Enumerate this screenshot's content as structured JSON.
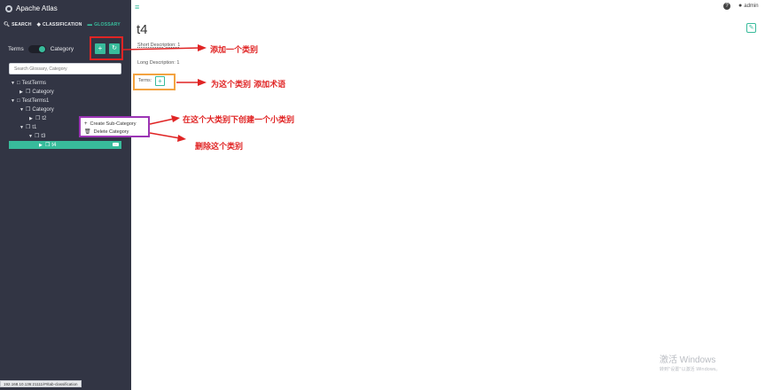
{
  "app": {
    "title": "Apache Atlas"
  },
  "tabs": [
    {
      "label": "SEARCH",
      "icon": "search-icon",
      "active": false
    },
    {
      "label": "CLASSIFICATION",
      "icon": "tag-icon",
      "active": false
    },
    {
      "label": "GLOSSARY",
      "icon": "folder-icon",
      "active": true
    }
  ],
  "toggle": {
    "left_label": "Terms",
    "right_label": "Category"
  },
  "search": {
    "placeholder": "Search Glossary, Category"
  },
  "tree": [
    {
      "label": "TestTerms",
      "icon": "folder-icon",
      "caret": "down"
    },
    {
      "label": "Category",
      "icon": "category-icon",
      "caret": "right"
    },
    {
      "label": "TestTerms1",
      "icon": "folder-icon",
      "caret": "down"
    },
    {
      "label": "Category",
      "icon": "category-icon",
      "caret": "down"
    },
    {
      "label": "t2",
      "icon": "category-icon",
      "caret": "right"
    },
    {
      "label": "t1",
      "icon": "category-icon",
      "caret": "down"
    },
    {
      "label": "t3",
      "icon": "category-icon",
      "caret": "down"
    },
    {
      "label": "t4",
      "icon": "category-icon",
      "caret": "right",
      "selected": true
    }
  ],
  "context_menu": {
    "create": "Create Sub-Category",
    "delete": "Delete Category"
  },
  "status_url": "192.168.10.136:21111/#!/tab-classification",
  "topbar": {
    "user": "admin"
  },
  "detail": {
    "title": "t4",
    "short_description": "Short Description: 1",
    "long_description": "Long Description: 1",
    "terms_label": "Terms:"
  },
  "annotations": {
    "add_category": "添加一个类别",
    "add_term": "为这个类别 添加术语",
    "create_sub": "在这个大类别下创建一个小类别",
    "delete": "删除这个类别"
  },
  "watermark": {
    "title": "激活 Windows",
    "subtitle": "转到\"设置\"以激活 Windows。"
  },
  "colors": {
    "sidebar": "#323544",
    "accent": "#38bb9b",
    "annotation": "#e02424",
    "highlight_orange": "#f3a341",
    "menu_border": "#9c35b5"
  }
}
